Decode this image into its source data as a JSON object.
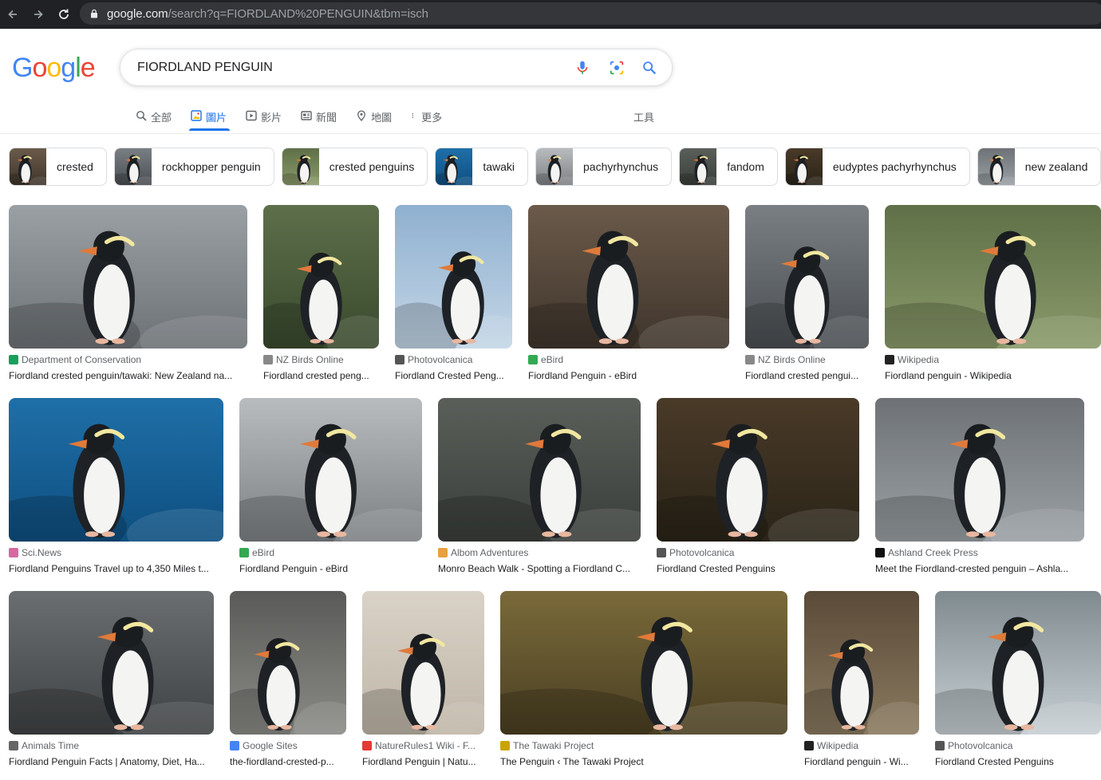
{
  "browser": {
    "url_host": "google.com",
    "url_path": "/search?q=FIORDLAND%20PENGUIN&tbm=isch"
  },
  "logo": {
    "letters": [
      "G",
      "o",
      "o",
      "g",
      "l",
      "e"
    ],
    "colors": [
      "#4285f4",
      "#ea4335",
      "#fbbc05",
      "#4285f4",
      "#34a853",
      "#ea4335"
    ]
  },
  "search": {
    "query": "FIORDLAND PENGUIN"
  },
  "tabs": [
    {
      "label": "全部",
      "icon": "search-icon"
    },
    {
      "label": "圖片",
      "icon": "image-icon"
    },
    {
      "label": "影片",
      "icon": "video-icon"
    },
    {
      "label": "新聞",
      "icon": "news-icon"
    },
    {
      "label": "地圖",
      "icon": "map-pin-icon"
    },
    {
      "label": "更多",
      "icon": "more-vert-icon"
    }
  ],
  "tools_label": "工具",
  "chips": [
    {
      "label": "crested"
    },
    {
      "label": "rockhopper penguin"
    },
    {
      "label": "crested penguins"
    },
    {
      "label": "tawaki"
    },
    {
      "label": "pachyrhynchus"
    },
    {
      "label": "fandom"
    },
    {
      "label": "eudyptes pachyrhynchus"
    },
    {
      "label": "new zealand"
    }
  ],
  "results": [
    {
      "source": "Department of Conservation",
      "title": "Fiordland crested penguin/tawaki: New Zealand na..."
    },
    {
      "source": "NZ Birds Online",
      "title": "Fiordland crested peng..."
    },
    {
      "source": "Photovolcanica",
      "title": "Fiordland Crested Peng..."
    },
    {
      "source": "eBird",
      "title": "Fiordland Penguin - eBird"
    },
    {
      "source": "NZ Birds Online",
      "title": "Fiordland crested pengui..."
    },
    {
      "source": "Wikipedia",
      "title": "Fiordland penguin - Wikipedia"
    },
    {
      "source": "Sci.News",
      "title": "Fiordland Penguins Travel up to 4,350 Miles t..."
    },
    {
      "source": "eBird",
      "title": "Fiordland Penguin - eBird"
    },
    {
      "source": "Albom Adventures",
      "title": "Monro Beach Walk - Spotting a Fiordland C..."
    },
    {
      "source": "Photovolcanica",
      "title": "Fiordland Crested Penguins"
    },
    {
      "source": "Ashland Creek Press",
      "title": "Meet the Fiordland-crested penguin – Ashla..."
    },
    {
      "source": "Animals Time",
      "title": "Fiordland Penguin Facts | Anatomy, Diet, Ha..."
    },
    {
      "source": "Google Sites",
      "title": "the-fiordland-crested-p..."
    },
    {
      "source": "NatureRules1 Wiki - F...",
      "title": "Fiordland Penguin | Natu..."
    },
    {
      "source": "The Tawaki Project",
      "title": "The Penguin ‹ The Tawaki Project"
    },
    {
      "source": "Wikipedia",
      "title": "Fiordland penguin - Wi..."
    },
    {
      "source": "Photovolcanica",
      "title": "Fiordland Crested Penguins"
    }
  ]
}
